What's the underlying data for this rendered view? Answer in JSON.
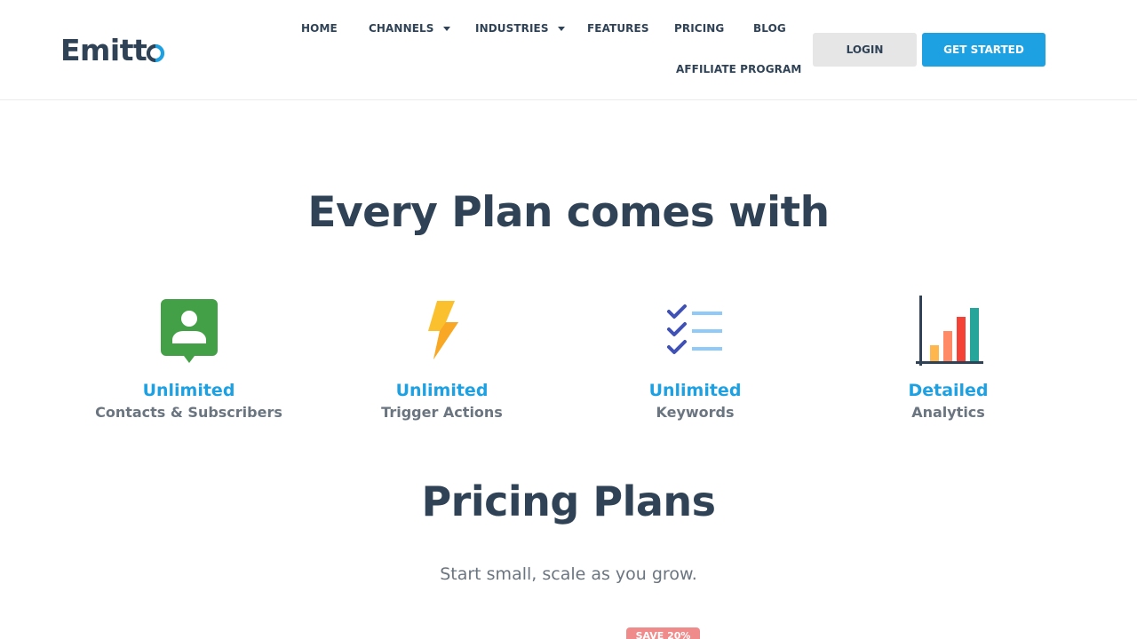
{
  "brand": {
    "name_prefix": "Emitt",
    "accent": "#1da1e2",
    "dark": "#2f4256"
  },
  "nav": {
    "home": "HOME",
    "channels": "CHANNELS",
    "industries": "INDUSTRIES",
    "features": "FEATURES",
    "pricing": "PRICING",
    "blog": "BLOG",
    "affiliate": "AFFILIATE PROGRAM"
  },
  "buttons": {
    "login": "LOGIN",
    "get_started": "GET STARTED"
  },
  "every_plan": {
    "heading": "Every Plan comes with",
    "features": [
      {
        "title": "Unlimited",
        "subtitle": "Contacts & Subscribers",
        "icon": "contact-card-icon"
      },
      {
        "title": "Unlimited",
        "subtitle": "Trigger Actions",
        "icon": "lightning-bolt-icon"
      },
      {
        "title": "Unlimited",
        "subtitle": "Keywords",
        "icon": "checklist-icon"
      },
      {
        "title": "Detailed",
        "subtitle": "Analytics",
        "icon": "bar-chart-icon"
      }
    ]
  },
  "pricing": {
    "heading": "Pricing Plans",
    "subheading": "Start small, scale as you grow.",
    "save_badge": "SAVE 20%"
  }
}
